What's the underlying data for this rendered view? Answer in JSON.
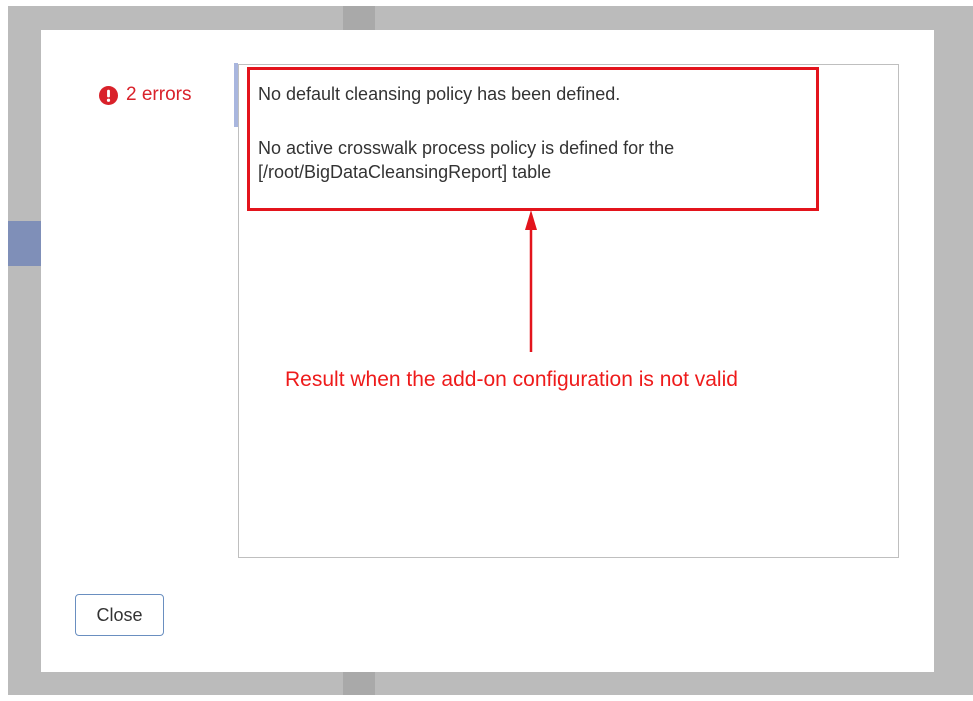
{
  "dialog": {
    "error_summary": {
      "icon": "exclamation-circle-icon",
      "label": "2 errors",
      "color": "#d9212a"
    },
    "errors": [
      "No default cleansing policy has been defined.",
      "No active crosswalk process policy is defined for the [/root/BigDataCleansingReport] table"
    ],
    "annotation": {
      "text": "Result when the add-on configuration is not valid",
      "color": "#ee1b1b"
    },
    "close_label": "Close"
  }
}
